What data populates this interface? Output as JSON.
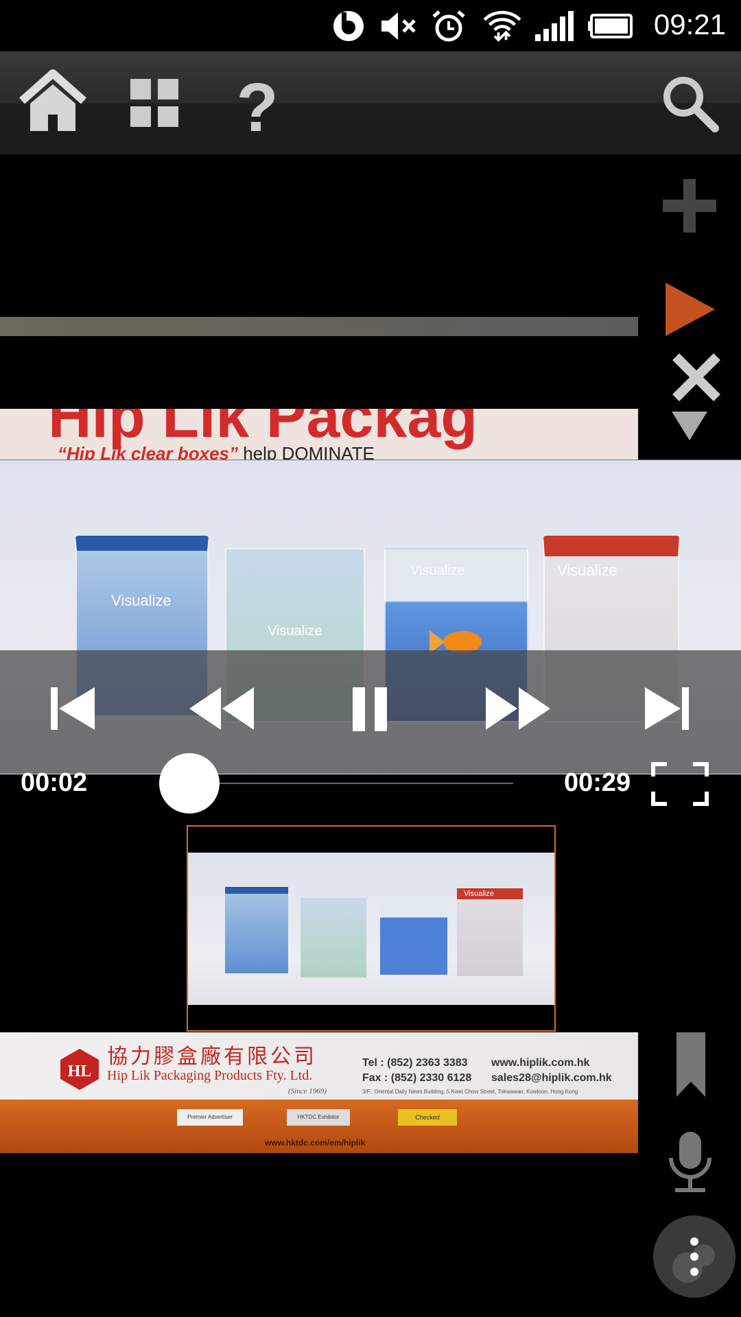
{
  "status_bar": {
    "time": "09:21",
    "icons": [
      "beats-audio-icon",
      "mute-icon",
      "alarm-icon",
      "wifi-icon",
      "signal-icon",
      "battery-icon"
    ]
  },
  "toolbar": {
    "buttons": [
      "home-icon",
      "grid-icon",
      "help-icon",
      "search-icon"
    ]
  },
  "right_rail": {
    "icons": [
      "add-icon",
      "play-icon",
      "close-icon",
      "triangle-down-icon",
      "bookmark-icon",
      "microphone-icon",
      "more-icon"
    ],
    "play_color": "#c4511f"
  },
  "ad_strip": {
    "headline": "Hip Lik Packag",
    "subline_highlight": "“Hip Lik clear boxes”",
    "subline_rest": " help DOMINATE"
  },
  "video": {
    "box_labels": [
      "Visualize",
      "Visualize",
      "Visualize",
      "Visualize"
    ],
    "controls": [
      "skip-previous-icon",
      "rewind-icon",
      "pause-icon",
      "fast-forward-icon",
      "skip-next-icon"
    ],
    "current_time": "00:02",
    "total_time": "00:29",
    "progress": 0.07
  },
  "thumbnail": {
    "box_label": "Visualize",
    "border_color": "#e06820"
  },
  "banner": {
    "company_chinese": "協力膠盒廠有限公司",
    "company_english": "Hip Lik Packaging Products Fty. Ltd.",
    "since": "(Since 1969)",
    "tel": "Tel : (852) 2363 3383",
    "fax": "Fax : (852) 2330 6128",
    "website": "www.hiplik.com.hk",
    "email": "sales28@hiplik.com.hk",
    "address": "3/F., Oriental Daily News Building, 5 Kwei Chow Street, Tokwawan, Kowloon, Hong Kong",
    "badges": [
      "Premier Advertiser",
      "HKTDC Exhibitor",
      "Checked"
    ],
    "url": "www.hktdc.com/em/hiplik"
  }
}
